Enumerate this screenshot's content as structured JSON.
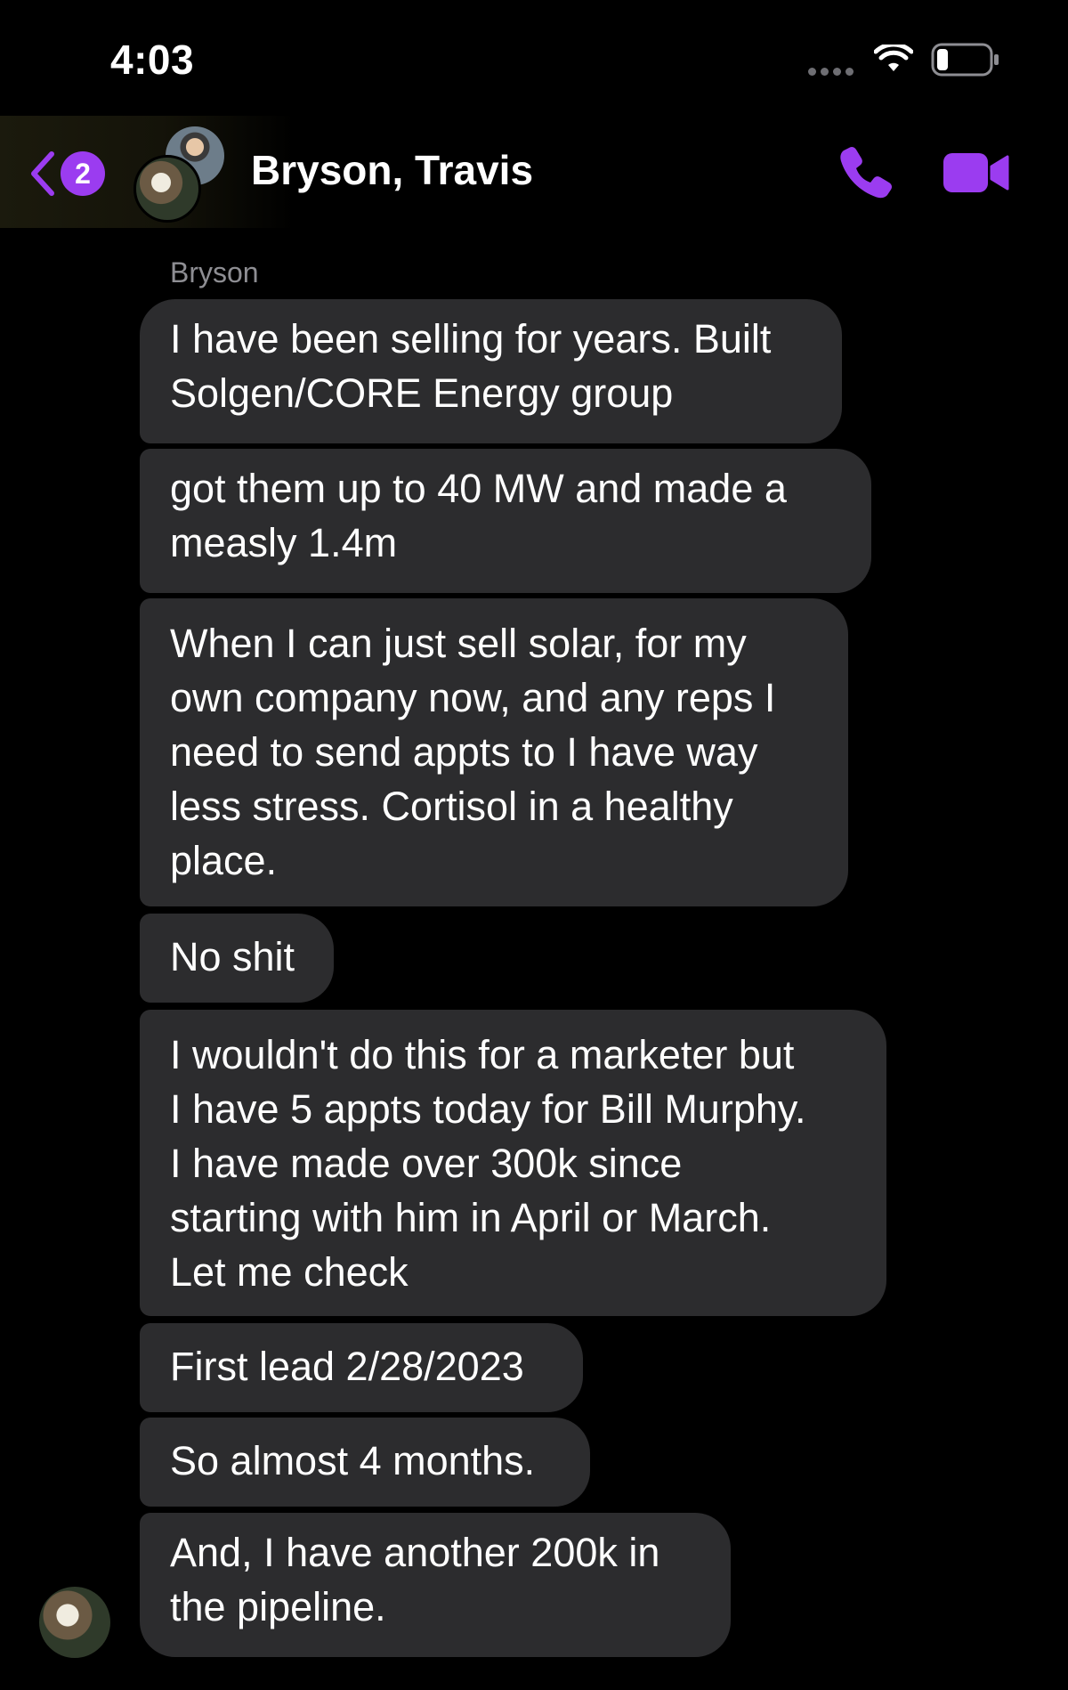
{
  "status_bar": {
    "time": "4:03"
  },
  "header": {
    "unread_count": "2",
    "title": "Bryson, Travis",
    "accent_color": "#9b3cf0"
  },
  "thread": {
    "sender_name": "Bryson",
    "bubble_color": "#2c2c2e",
    "messages": [
      "I have been selling for years. Built\nSolgen/CORE Energy group",
      "got them up to 40 MW and made a\nmeasly 1.4m",
      "When I can just sell solar, for my\nown company now, and any reps I\nneed to send appts to I have way\nless stress. Cortisol in a healthy\nplace.",
      "No shit",
      "I wouldn't do this for a marketer but\nI have 5 appts today for Bill Murphy.\nI have made over 300k since\nstarting with him in April or March.\nLet me check",
      "First lead 2/28/2023",
      "So almost 4 months.",
      "And, I have another 200k in\nthe pipeline."
    ]
  },
  "icons": {
    "back": "chevron-left-icon",
    "call": "phone-icon",
    "video": "video-camera-icon",
    "wifi": "wifi-icon",
    "battery": "battery-icon"
  }
}
